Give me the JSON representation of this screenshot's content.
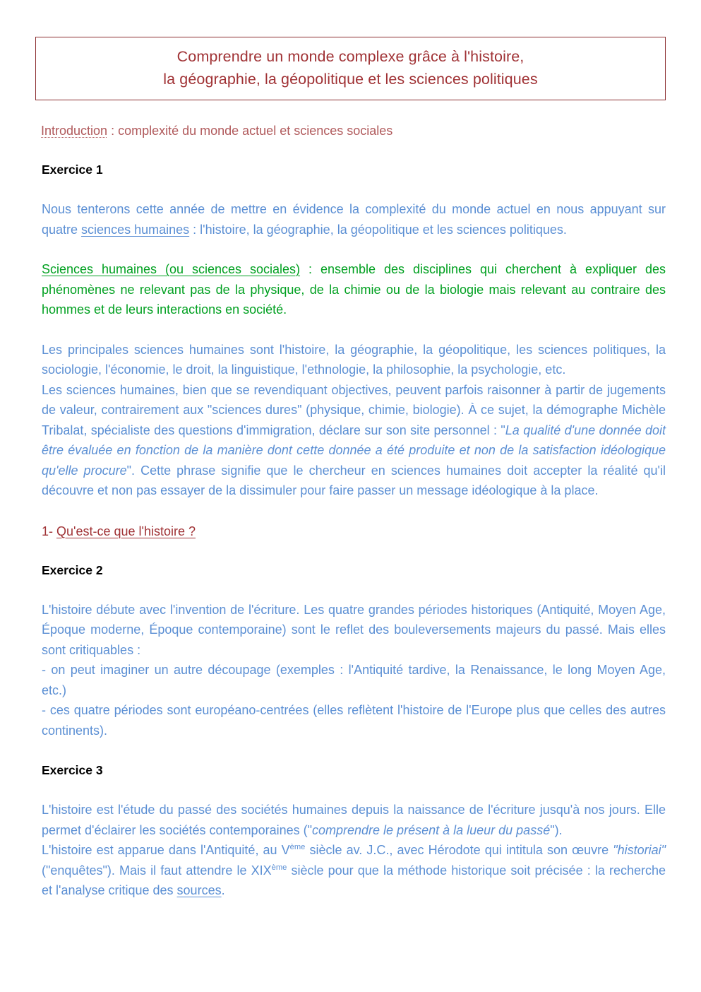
{
  "document": {
    "title_box": {
      "line1": "Comprendre un monde complexe grâce à l'histoire,",
      "line2": "la géographie, la géopolitique et les sciences politiques",
      "border_color": "#8B2E30",
      "text_color": "#A03235"
    },
    "introduction": {
      "label": "Introduction",
      "rest": " : complexité du monde actuel et sciences sociales",
      "color": "#B0595B"
    },
    "exercise1": {
      "heading": "Exercice 1",
      "p1": {
        "part1": "Nous tenterons cette année de mettre en évidence la complexité du monde actuel en nous appuyant sur quatre ",
        "underlined": "sciences humaines",
        "part2": " : l'histoire, la géographie, la géopolitique et les sciences politiques."
      },
      "p2_green": {
        "underlined": "Sciences humaines (ou sciences sociales)",
        "rest": " : ensemble des disciplines qui cherchent à expliquer des phénomènes ne relevant pas de la physique, de la chimie ou de la biologie mais relevant au contraire des hommes et de leurs interactions en société."
      },
      "p3": "Les principales sciences humaines sont l'histoire, la géographie, la géopolitique, les sciences politiques, la sociologie, l'économie, le droit, la linguistique, l'ethnologie, la philosophie, la psychologie, etc.",
      "p4": {
        "part1": "Les sciences humaines, bien que se revendiquant objectives, peuvent parfois raisonner à partir de jugements de valeur, contrairement aux \"sciences dures\" (physique, chimie, biologie). À ce sujet, la démographe Michèle Tribalat, spécialiste des questions d'immigration, déclare sur son site personnel : \"",
        "quote_italic": "La qualité d'une donnée doit être évaluée en fonction de la manière dont cette donnée a été produite et non de la satisfaction idéologique qu'elle procure",
        "part2": "\". Cette phrase signifie que le chercheur en sciences humaines doit accepter la réalité qu'il découvre et non pas essayer de la dissimuler pour faire passer un message idéologique à la place."
      }
    },
    "section1": {
      "number": "1- ",
      "underlined_title": "Qu'est-ce que l'histoire ?",
      "color": "#A03235"
    },
    "exercise2": {
      "heading": "Exercice 2",
      "p1": "L'histoire débute avec l'invention de l'écriture. Les quatre grandes périodes historiques (Antiquité, Moyen Age, Époque moderne, Époque contemporaine) sont le reflet des bouleversements majeurs du passé. Mais elles sont critiquables :",
      "p2": "- on peut imaginer un autre découpage (exemples : l'Antiquité tardive, la Renaissance, le long Moyen Age, etc.)",
      "p3": "- ces quatre périodes sont européano-centrées (elles reflètent l'histoire de l'Europe plus que celles des autres continents)."
    },
    "exercise3": {
      "heading": "Exercice 3",
      "p1": {
        "part1": "L'histoire est l'étude du passé des sociétés humaines depuis la naissance de l'écriture jusqu'à nos jours. Elle permet d'éclairer les sociétés contemporaines (\"",
        "quote_italic": "comprendre le présent à la lueur du passé",
        "part2": "\")."
      },
      "p2": {
        "part1": "L'histoire est apparue dans l'Antiquité, au V",
        "sup1": "ème",
        "part2": " siècle av. J.C., avec Hérodote qui  intitula son œuvre ",
        "quote_italic": "\"historiai\"",
        "part3": " (\"enquêtes\"). Mais il faut attendre le XIX",
        "sup2": "ème",
        "part4": " siècle pour que la méthode historique soit précisée : la recherche et l'analyse critique des ",
        "underlined": "sources",
        "part5": "."
      }
    },
    "colors": {
      "blue_body": "#5B8FD4",
      "green_body": "#00A020",
      "red_title": "#A03235",
      "red_intro": "#B0595B",
      "black_heading": "#000000"
    }
  }
}
